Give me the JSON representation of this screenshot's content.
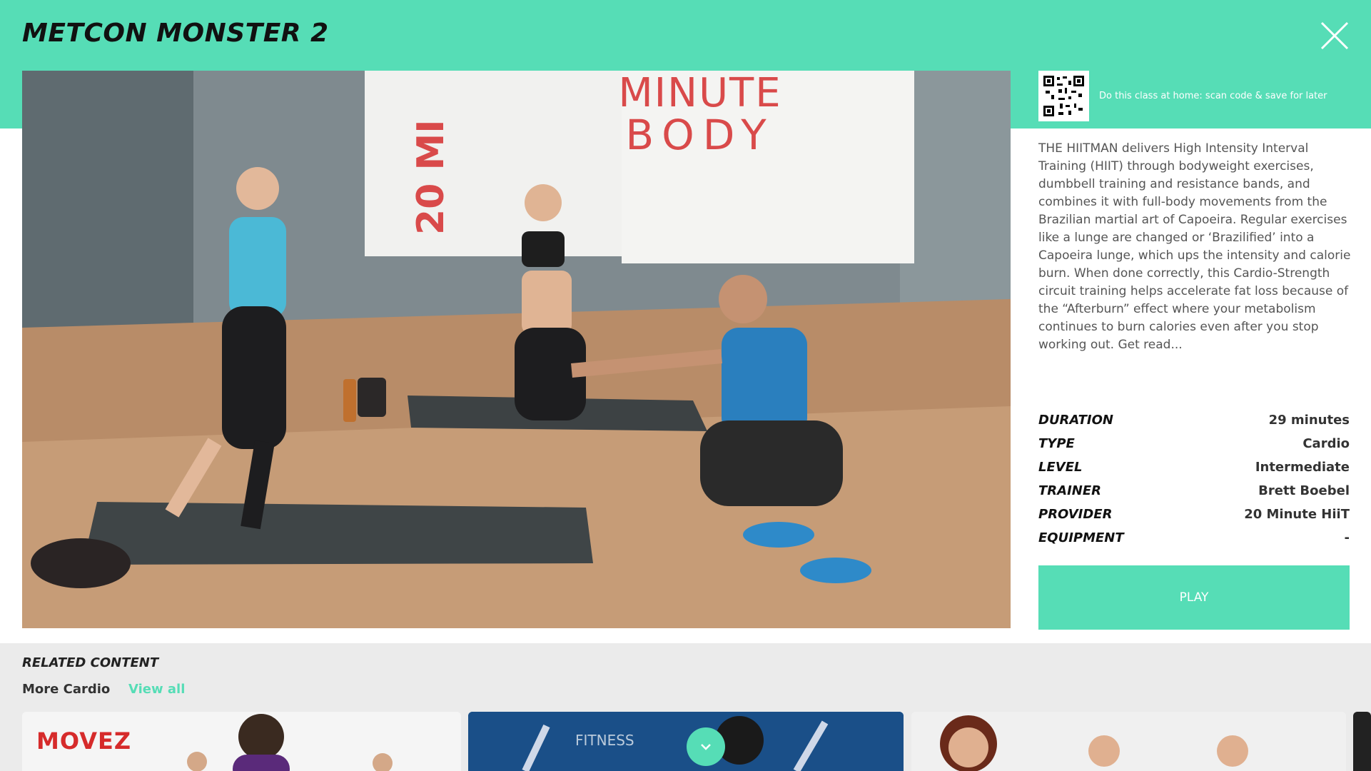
{
  "header": {
    "title": "METCON MONSTER 2"
  },
  "video": {
    "banner_left_text": "20 MI",
    "banner_right_line1": "MINUTE",
    "banner_right_line2": "BODY"
  },
  "qr": {
    "text": "Do this class at home: scan code & save for later"
  },
  "description": "THE HIITMAN delivers High Intensity Interval Training (HIIT) through bodyweight exercises, dumbbell training and resistance bands, and combines it with full-body movements from the Brazilian martial art of Capoeira. Regular exercises like a lunge are changed or ‘Brazilified’ into a Capoeira lunge, which ups the intensity and calorie burn. When done correctly, this Cardio-Strength circuit training helps accelerate fat loss because of the “Afterburn” effect where your metabolism continues to burn calories even after you stop working out. Get read...",
  "specs": [
    {
      "key": "DURATION",
      "value": "29 minutes"
    },
    {
      "key": "TYPE",
      "value": "Cardio"
    },
    {
      "key": "LEVEL",
      "value": "Intermediate"
    },
    {
      "key": "TRAINER",
      "value": "Brett Boebel"
    },
    {
      "key": "PROVIDER",
      "value": "20 Minute HiiT"
    },
    {
      "key": "EQUIPMENT",
      "value": "-"
    }
  ],
  "play_label": "PLAY",
  "related": {
    "title": "RELATED CONTENT",
    "category": "More Cardio",
    "view_all": "View all",
    "cards": [
      {
        "label": "MOVEZ"
      },
      {
        "label": "FITNESS"
      },
      {
        "label": ""
      }
    ]
  },
  "colors": {
    "accent": "#56ddb6",
    "related_bg": "#ebebeb"
  }
}
